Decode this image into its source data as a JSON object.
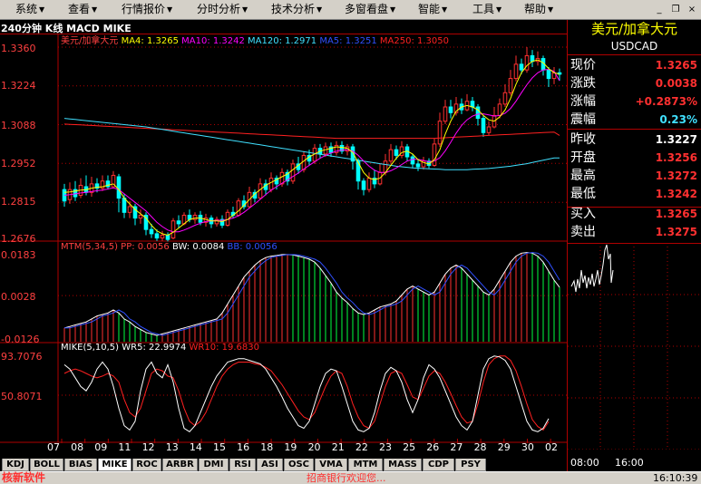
{
  "menu": [
    {
      "label": "系统",
      "arrow": "▼"
    },
    {
      "label": "查看",
      "arrow": "▼"
    },
    {
      "label": "行情报价",
      "arrow": "▼"
    },
    {
      "label": "分时分析",
      "arrow": "▼"
    },
    {
      "label": "技术分析",
      "arrow": "▼"
    },
    {
      "label": "多窗看盘",
      "arrow": "▼"
    },
    {
      "label": "智能",
      "arrow": "▼"
    },
    {
      "label": "工具",
      "arrow": "▼"
    },
    {
      "label": "帮助",
      "arrow": "▼"
    }
  ],
  "window_buttons": {
    "minimize": "_",
    "restore": "❐",
    "close": "×"
  },
  "chart_title": "240分钟 K线 MACD MIKE",
  "ma_legend": [
    {
      "label": "美元/加拿大元",
      "color": "#ff4040"
    },
    {
      "label": "MA4: 1.3265",
      "color": "#ffff00"
    },
    {
      "label": "MA10: 1.3242",
      "color": "#ff00ff"
    },
    {
      "label": "MA120: 1.2971",
      "color": "#40e0ff"
    },
    {
      "label": "MA5: 1.3251",
      "color": "#0000ff"
    },
    {
      "label": "MA250: 1.3050",
      "color": "#ff2020"
    }
  ],
  "mtm_legend": [
    {
      "label": "MTM(5,34,5)",
      "color": "#ff4040"
    },
    {
      "label": "PP: 0.0056",
      "color": "#ff4040"
    },
    {
      "label": "BW: 0.0084",
      "color": "#ffffff"
    },
    {
      "label": "BB: 0.0056",
      "color": "#0000ff"
    }
  ],
  "mike_legend": [
    {
      "label": "MIKE(5,10,5)",
      "color": "#ffffff"
    },
    {
      "label": "WR5: 22.9974",
      "color": "#ffffff"
    },
    {
      "label": "WR10: 19.6830",
      "color": "#ff2020"
    }
  ],
  "price_axis": [
    "1.3360",
    "1.3224",
    "1.3088",
    "1.2952",
    "1.2815",
    "1.2676"
  ],
  "mtm_axis": [
    "0.0183",
    "0.0028",
    "-0.0126"
  ],
  "mike_axis": [
    "93.7076",
    "50.8071"
  ],
  "x_axis": [
    "07",
    "08",
    "09",
    "11",
    "12",
    "13",
    "14",
    "15",
    "16",
    "18",
    "19",
    "20",
    "21",
    "22",
    "23",
    "25",
    "26",
    "27",
    "28",
    "29",
    "30",
    "02"
  ],
  "quote": {
    "name": "美元/加拿大元",
    "code": "USDCAD",
    "rows": [
      {
        "label": "现价",
        "value": "1.3265",
        "color": "#ff3030"
      },
      {
        "label": "涨跌",
        "value": "0.0038",
        "color": "#ff3030"
      },
      {
        "label": "涨幅",
        "value": "+0.2873%",
        "color": "#ff3030"
      },
      {
        "label": "震幅",
        "value": "0.23%",
        "color": "#40e0ff"
      },
      {
        "label": "昨收",
        "value": "1.3227",
        "color": "#ffffff"
      },
      {
        "label": "开盘",
        "value": "1.3256",
        "color": "#ff3030"
      },
      {
        "label": "最高",
        "value": "1.3272",
        "color": "#ff3030"
      },
      {
        "label": "最低",
        "value": "1.3242",
        "color": "#ff3030"
      },
      {
        "label": "买入",
        "value": "1.3265",
        "color": "#ff3030"
      },
      {
        "label": "卖出",
        "value": "1.3275",
        "color": "#ff3030"
      }
    ],
    "time_axis": [
      "08:00",
      "16:00"
    ]
  },
  "tabs": [
    "KDJ",
    "BOLL",
    "BIAS",
    "MIKE",
    "ROC",
    "ARBR",
    "DMI",
    "RSI",
    "ASI",
    "OSC",
    "VMA",
    "MTM",
    "MASS",
    "CDP",
    "PSY"
  ],
  "active_tab": "MIKE",
  "status": {
    "brand": "核新软件",
    "message": "招商银行欢迎您...",
    "time": "16:10:39"
  },
  "colors": {
    "up": "#ff3030",
    "down": "#00ffff",
    "grid": "#b00000",
    "panel_bg": "#000000"
  },
  "chart_data": {
    "type": "candlestick",
    "title": "240分钟 K线 MACD MIKE",
    "price_ylim": [
      1.2676,
      1.336
    ],
    "candles": [
      [
        1.286,
        1.282,
        1.288,
        1.28
      ],
      [
        1.2825,
        1.286,
        1.2885,
        1.281
      ],
      [
        1.286,
        1.2835,
        1.289,
        1.282
      ],
      [
        1.284,
        1.2875,
        1.29,
        1.283
      ],
      [
        1.287,
        1.285,
        1.291,
        1.284
      ],
      [
        1.285,
        1.288,
        1.2905,
        1.2835
      ],
      [
        1.288,
        1.2865,
        1.29,
        1.285
      ],
      [
        1.2865,
        1.289,
        1.291,
        1.2855
      ],
      [
        1.289,
        1.287,
        1.291,
        1.286
      ],
      [
        1.287,
        1.291,
        1.2925,
        1.2865
      ],
      [
        1.2905,
        1.283,
        1.2915,
        1.278
      ],
      [
        1.283,
        1.278,
        1.2845,
        1.276
      ],
      [
        1.278,
        1.28,
        1.282,
        1.276
      ],
      [
        1.28,
        1.276,
        1.281,
        1.2735
      ],
      [
        1.276,
        1.277,
        1.279,
        1.274
      ],
      [
        1.277,
        1.272,
        1.278,
        1.27
      ],
      [
        1.272,
        1.2705,
        1.274,
        1.269
      ],
      [
        1.2705,
        1.269,
        1.272,
        1.268
      ],
      [
        1.269,
        1.27,
        1.2715,
        1.268
      ],
      [
        1.27,
        1.2685,
        1.271,
        1.2678
      ],
      [
        1.269,
        1.275,
        1.276,
        1.2685
      ],
      [
        1.275,
        1.274,
        1.277,
        1.2725
      ],
      [
        1.274,
        1.277,
        1.278,
        1.2735
      ],
      [
        1.277,
        1.2755,
        1.279,
        1.2745
      ],
      [
        1.2755,
        1.277,
        1.278,
        1.274
      ],
      [
        1.277,
        1.2745,
        1.2785,
        1.2735
      ],
      [
        1.2745,
        1.276,
        1.2775,
        1.273
      ],
      [
        1.276,
        1.274,
        1.277,
        1.2725
      ],
      [
        1.274,
        1.2755,
        1.2765,
        1.273
      ],
      [
        1.2755,
        1.2735,
        1.277,
        1.2725
      ],
      [
        1.2735,
        1.278,
        1.279,
        1.273
      ],
      [
        1.278,
        1.277,
        1.28,
        1.276
      ],
      [
        1.277,
        1.282,
        1.283,
        1.2765
      ],
      [
        1.282,
        1.28,
        1.284,
        1.279
      ],
      [
        1.28,
        1.285,
        1.287,
        1.2795
      ],
      [
        1.285,
        1.283,
        1.286,
        1.2815
      ],
      [
        1.283,
        1.288,
        1.29,
        1.2825
      ],
      [
        1.288,
        1.286,
        1.2895,
        1.284
      ],
      [
        1.286,
        1.29,
        1.292,
        1.285
      ],
      [
        1.29,
        1.288,
        1.291,
        1.286
      ],
      [
        1.288,
        1.292,
        1.2935,
        1.287
      ],
      [
        1.292,
        1.289,
        1.293,
        1.2875
      ],
      [
        1.289,
        1.295,
        1.2965,
        1.288
      ],
      [
        1.295,
        1.293,
        1.2975,
        1.2915
      ],
      [
        1.293,
        1.298,
        1.2995,
        1.292
      ],
      [
        1.298,
        1.296,
        1.3,
        1.2945
      ],
      [
        1.296,
        1.3005,
        1.302,
        1.295
      ],
      [
        1.3005,
        1.2985,
        1.302,
        1.297
      ],
      [
        1.2985,
        1.301,
        1.3025,
        1.2975
      ],
      [
        1.301,
        1.299,
        1.3025,
        1.2975
      ],
      [
        1.299,
        1.3015,
        1.303,
        1.298
      ],
      [
        1.3015,
        1.2995,
        1.303,
        1.2985
      ],
      [
        1.2995,
        1.301,
        1.302,
        1.298
      ],
      [
        1.301,
        1.296,
        1.302,
        1.293
      ],
      [
        1.296,
        1.289,
        1.297,
        1.286
      ],
      [
        1.289,
        1.286,
        1.29,
        1.284
      ],
      [
        1.286,
        1.29,
        1.292,
        1.285
      ],
      [
        1.29,
        1.288,
        1.293,
        1.2865
      ],
      [
        1.288,
        1.292,
        1.295,
        1.2875
      ],
      [
        1.292,
        1.296,
        1.2985,
        1.291
      ],
      [
        1.296,
        1.3,
        1.302,
        1.295
      ],
      [
        1.3,
        1.298,
        1.3015,
        1.2965
      ],
      [
        1.298,
        1.301,
        1.303,
        1.297
      ],
      [
        1.301,
        1.2975,
        1.302,
        1.296
      ],
      [
        1.2975,
        1.295,
        1.2985,
        1.2935
      ],
      [
        1.295,
        1.294,
        1.2965,
        1.2925
      ],
      [
        1.294,
        1.296,
        1.2975,
        1.293
      ],
      [
        1.296,
        1.2945,
        1.297,
        1.2935
      ],
      [
        1.2945,
        1.302,
        1.304,
        1.294
      ],
      [
        1.302,
        1.31,
        1.313,
        1.301
      ],
      [
        1.31,
        1.315,
        1.3175,
        1.309
      ],
      [
        1.315,
        1.313,
        1.3175,
        1.311
      ],
      [
        1.313,
        1.316,
        1.3185,
        1.312
      ],
      [
        1.316,
        1.314,
        1.318,
        1.3125
      ],
      [
        1.314,
        1.317,
        1.3195,
        1.3135
      ],
      [
        1.317,
        1.315,
        1.3185,
        1.3135
      ],
      [
        1.315,
        1.311,
        1.316,
        1.3085
      ],
      [
        1.311,
        1.306,
        1.312,
        1.3045
      ],
      [
        1.306,
        1.308,
        1.31,
        1.305
      ],
      [
        1.308,
        1.312,
        1.315,
        1.3075
      ],
      [
        1.312,
        1.316,
        1.318,
        1.311
      ],
      [
        1.316,
        1.32,
        1.323,
        1.315
      ],
      [
        1.32,
        1.325,
        1.328,
        1.319
      ],
      [
        1.325,
        1.33,
        1.333,
        1.324
      ],
      [
        1.33,
        1.328,
        1.332,
        1.3265
      ],
      [
        1.328,
        1.333,
        1.336,
        1.327
      ],
      [
        1.333,
        1.331,
        1.335,
        1.329
      ],
      [
        1.331,
        1.332,
        1.3345,
        1.3295
      ],
      [
        1.332,
        1.328,
        1.333,
        1.326
      ],
      [
        1.328,
        1.325,
        1.329,
        1.322
      ],
      [
        1.325,
        1.327,
        1.329,
        1.323
      ],
      [
        1.327,
        1.3265,
        1.3285,
        1.3242
      ]
    ],
    "ma4": [
      1.285,
      1.2852,
      1.2855,
      1.2858,
      1.286,
      1.2865,
      1.2868,
      1.287,
      1.2875,
      1.288,
      1.286,
      1.283,
      1.281,
      1.279,
      1.2775,
      1.276,
      1.2735,
      1.2715,
      1.2705,
      1.27,
      1.271,
      1.2725,
      1.274,
      1.2755,
      1.276,
      1.276,
      1.2755,
      1.275,
      1.275,
      1.2748,
      1.2755,
      1.277,
      1.2785,
      1.2805,
      1.2825,
      1.2845,
      1.286,
      1.2875,
      1.2885,
      1.2895,
      1.2905,
      1.2915,
      1.293,
      1.2945,
      1.296,
      1.2975,
      1.2985,
      1.2995,
      1.3,
      1.3005,
      1.301,
      1.3008,
      1.3005,
      1.299,
      1.2955,
      1.292,
      1.29,
      1.2895,
      1.29,
      1.292,
      1.2945,
      1.297,
      1.299,
      1.2995,
      1.2985,
      1.2965,
      1.2955,
      1.295,
      1.2965,
      1.3,
      1.3055,
      1.31,
      1.3135,
      1.315,
      1.3155,
      1.315,
      1.314,
      1.312,
      1.3105,
      1.31,
      1.3115,
      1.314,
      1.318,
      1.323,
      1.327,
      1.3295,
      1.331,
      1.3315,
      1.3305,
      1.3285,
      1.327,
      1.3265
    ],
    "ma10": [
      1.284,
      1.2842,
      1.2845,
      1.2848,
      1.285,
      1.2853,
      1.2856,
      1.2858,
      1.2862,
      1.2866,
      1.286,
      1.2845,
      1.283,
      1.2815,
      1.28,
      1.2785,
      1.2765,
      1.2745,
      1.273,
      1.2718,
      1.2712,
      1.2712,
      1.2718,
      1.2726,
      1.2735,
      1.2742,
      1.2748,
      1.275,
      1.2752,
      1.2752,
      1.2755,
      1.276,
      1.2768,
      1.278,
      1.2795,
      1.281,
      1.2826,
      1.2842,
      1.2858,
      1.287,
      1.2882,
      1.2894,
      1.2906,
      1.2918,
      1.2932,
      1.2945,
      1.2958,
      1.297,
      1.298,
      1.2988,
      1.2995,
      1.2998,
      1.3,
      1.2995,
      1.298,
      1.296,
      1.2942,
      1.2928,
      1.292,
      1.292,
      1.2926,
      1.2936,
      1.2948,
      1.296,
      1.2966,
      1.2966,
      1.2962,
      1.2958,
      1.296,
      1.2972,
      1.2996,
      1.3026,
      1.3058,
      1.3085,
      1.3105,
      1.3118,
      1.3125,
      1.3126,
      1.3122,
      1.3118,
      1.312,
      1.3128,
      1.3145,
      1.317,
      1.32,
      1.3228,
      1.3252,
      1.327,
      1.328,
      1.3282,
      1.3275,
      1.3242
    ],
    "ma120": [
      1.311,
      1.3108,
      1.3106,
      1.3104,
      1.3102,
      1.31,
      1.3098,
      1.3096,
      1.3094,
      1.3092,
      1.309,
      1.3088,
      1.3086,
      1.3084,
      1.3082,
      1.308,
      1.3077,
      1.3074,
      1.3071,
      1.3068,
      1.3065,
      1.3062,
      1.3059,
      1.3056,
      1.3053,
      1.305,
      1.3047,
      1.3044,
      1.3041,
      1.3038,
      1.3035,
      1.3032,
      1.3029,
      1.3026,
      1.3023,
      1.302,
      1.3017,
      1.3014,
      1.3011,
      1.3008,
      1.3005,
      1.3002,
      1.2999,
      1.2996,
      1.2993,
      1.299,
      1.2987,
      1.2984,
      1.2981,
      1.2978,
      1.2975,
      1.2972,
      1.2969,
      1.2966,
      1.2963,
      1.296,
      1.2957,
      1.2954,
      1.2951,
      1.2948,
      1.2945,
      1.2942,
      1.294,
      1.2938,
      1.2936,
      1.2935,
      1.2934,
      1.2933,
      1.2932,
      1.2931,
      1.293,
      1.293,
      1.293,
      1.293,
      1.293,
      1.2931,
      1.2932,
      1.2933,
      1.2934,
      1.2936,
      1.2938,
      1.294,
      1.2942,
      1.2945,
      1.2948,
      1.2951,
      1.2955,
      1.2959,
      1.2963,
      1.2967,
      1.2971,
      1.2971
    ],
    "ma250": [
      1.309,
      1.3089,
      1.3088,
      1.3087,
      1.3086,
      1.3085,
      1.3084,
      1.3083,
      1.3082,
      1.3081,
      1.308,
      1.3079,
      1.3078,
      1.3077,
      1.3076,
      1.3075,
      1.3074,
      1.3073,
      1.3072,
      1.3071,
      1.307,
      1.3069,
      1.3068,
      1.3067,
      1.3066,
      1.3065,
      1.3064,
      1.3063,
      1.3062,
      1.3061,
      1.306,
      1.3059,
      1.3058,
      1.3057,
      1.3056,
      1.3055,
      1.3054,
      1.3053,
      1.3052,
      1.3051,
      1.305,
      1.3049,
      1.3048,
      1.3047,
      1.3046,
      1.3045,
      1.3044,
      1.3043,
      1.3042,
      1.3041,
      1.304,
      1.304,
      1.304,
      1.304,
      1.304,
      1.304,
      1.304,
      1.304,
      1.304,
      1.304,
      1.304,
      1.304,
      1.304,
      1.304,
      1.304,
      1.304,
      1.304,
      1.304,
      1.304,
      1.3041,
      1.3042,
      1.3043,
      1.3044,
      1.3045,
      1.3046,
      1.3047,
      1.3048,
      1.3049,
      1.305,
      1.3051,
      1.3052,
      1.3053,
      1.3054,
      1.3055,
      1.3056,
      1.3057,
      1.3058,
      1.3059,
      1.306,
      1.3061,
      1.3062,
      1.305
    ],
    "mtm_ylim": [
      -0.0126,
      0.0183
    ],
    "mtm": [
      -0.008,
      -0.0075,
      -0.007,
      -0.0065,
      -0.006,
      -0.005,
      -0.004,
      -0.0035,
      -0.003,
      -0.002,
      -0.003,
      -0.005,
      -0.006,
      -0.0075,
      -0.0085,
      -0.0095,
      -0.01,
      -0.0105,
      -0.01,
      -0.0095,
      -0.009,
      -0.0085,
      -0.008,
      -0.0075,
      -0.007,
      -0.0065,
      -0.006,
      -0.0055,
      -0.005,
      -0.003,
      0.0,
      0.003,
      0.006,
      0.009,
      0.011,
      0.013,
      0.0145,
      0.0155,
      0.016,
      0.0162,
      0.0165,
      0.0165,
      0.0164,
      0.016,
      0.0155,
      0.015,
      0.014,
      0.012,
      0.0095,
      0.007,
      0.004,
      0.002,
      0.0005,
      -0.0015,
      -0.003,
      -0.0035,
      -0.003,
      -0.002,
      -0.001,
      -0.0005,
      0.0,
      0.001,
      0.003,
      0.005,
      0.006,
      0.005,
      0.004,
      0.003,
      0.004,
      0.007,
      0.01,
      0.012,
      0.013,
      0.012,
      0.01,
      0.008,
      0.006,
      0.004,
      0.003,
      0.005,
      0.008,
      0.011,
      0.014,
      0.016,
      0.017,
      0.0172,
      0.017,
      0.016,
      0.014,
      0.011,
      0.008,
      0.0056
    ],
    "mike_ylim": [
      0,
      100
    ],
    "wr5": [
      85,
      80,
      70,
      60,
      55,
      65,
      80,
      88,
      80,
      60,
      35,
      15,
      10,
      20,
      55,
      80,
      88,
      75,
      70,
      85,
      65,
      35,
      12,
      8,
      15,
      30,
      45,
      60,
      72,
      80,
      88,
      90,
      92,
      92,
      90,
      88,
      86,
      80,
      70,
      60,
      48,
      35,
      25,
      15,
      12,
      20,
      40,
      60,
      75,
      80,
      78,
      60,
      40,
      20,
      10,
      8,
      12,
      30,
      55,
      75,
      82,
      78,
      65,
      45,
      30,
      45,
      70,
      85,
      80,
      70,
      55,
      40,
      25,
      15,
      10,
      20,
      50,
      80,
      92,
      95,
      94,
      90,
      80,
      60,
      40,
      20,
      10,
      8,
      12,
      22.9974
    ],
    "wr10": [
      75,
      78,
      80,
      78,
      75,
      72,
      70,
      72,
      75,
      72,
      65,
      45,
      30,
      25,
      35,
      55,
      75,
      80,
      78,
      72,
      70,
      55,
      35,
      20,
      15,
      20,
      30,
      45,
      60,
      72,
      80,
      85,
      88,
      88,
      88,
      86,
      85,
      82,
      78,
      70,
      62,
      52,
      42,
      32,
      25,
      22,
      30,
      45,
      60,
      72,
      78,
      75,
      60,
      40,
      25,
      15,
      12,
      20,
      40,
      60,
      75,
      78,
      75,
      62,
      48,
      45,
      58,
      72,
      78,
      75,
      65,
      52,
      38,
      25,
      18,
      20,
      40,
      65,
      85,
      92,
      95,
      95,
      90,
      78,
      60,
      40,
      22,
      14,
      10,
      19.683
    ]
  }
}
